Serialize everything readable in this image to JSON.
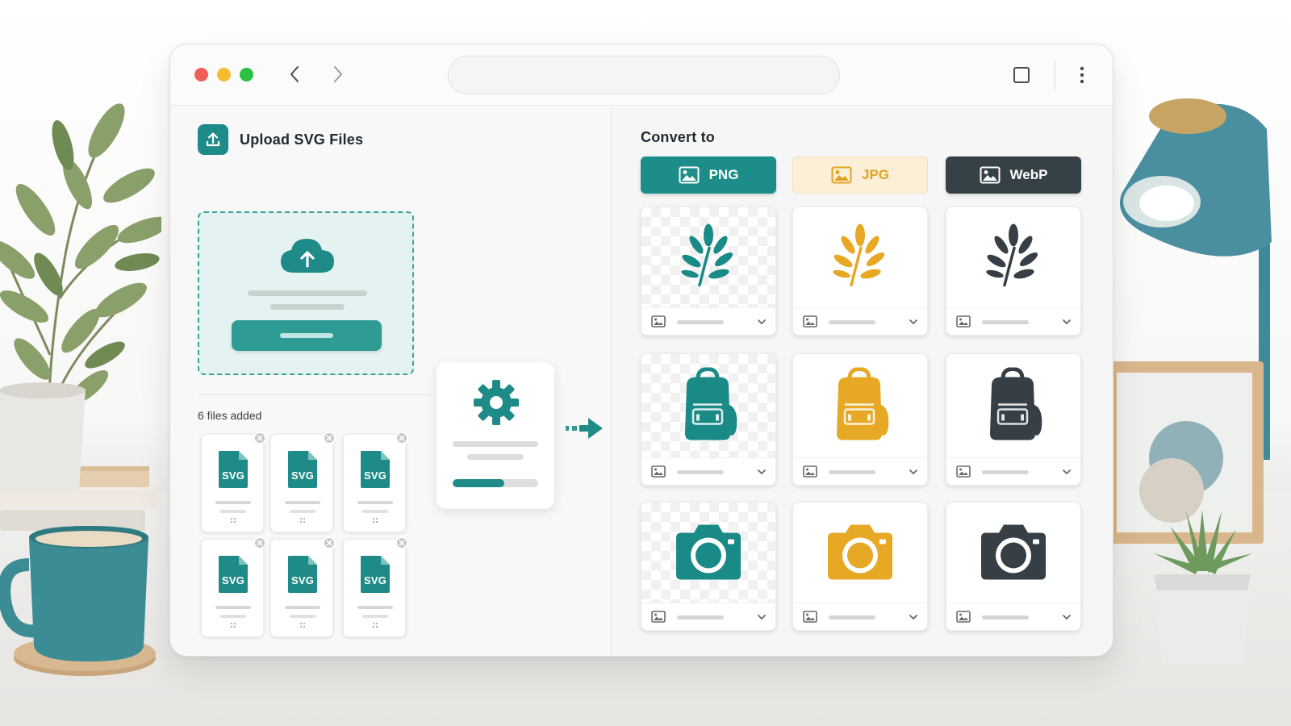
{
  "left_panel": {
    "upload_title": "Upload SVG Files",
    "files_added_label": "6 files added",
    "files": [
      {
        "ext": "SVG"
      },
      {
        "ext": "SVG"
      },
      {
        "ext": "SVG"
      },
      {
        "ext": "SVG"
      },
      {
        "ext": "SVG"
      },
      {
        "ext": "SVG"
      }
    ]
  },
  "processing": {
    "progress": 0.6,
    "icon": "gear-icon"
  },
  "right_panel": {
    "convert_title": "Convert to",
    "formats": [
      {
        "label": "PNG",
        "color": "#1c8d89",
        "selected": true
      },
      {
        "label": "JPG",
        "color": "#e2a324",
        "selected": false
      },
      {
        "label": "WebP",
        "color": "#364147",
        "selected": false
      }
    ],
    "results": [
      {
        "icon": "leaf-icon",
        "format": "PNG",
        "color": "#1a8a86",
        "transparent_bg": true
      },
      {
        "icon": "leaf-icon",
        "format": "JPG",
        "color": "#e6a825",
        "transparent_bg": false
      },
      {
        "icon": "leaf-icon",
        "format": "WebP",
        "color": "#353f45",
        "transparent_bg": false
      },
      {
        "icon": "backpack-icon",
        "format": "PNG",
        "color": "#1a8a86",
        "transparent_bg": true
      },
      {
        "icon": "backpack-icon",
        "format": "JPG",
        "color": "#e6a825",
        "transparent_bg": false
      },
      {
        "icon": "backpack-icon",
        "format": "WebP",
        "color": "#353f45",
        "transparent_bg": false
      },
      {
        "icon": "camera-icon",
        "format": "PNG",
        "color": "#1a8a86",
        "transparent_bg": true
      },
      {
        "icon": "camera-icon",
        "format": "JPG",
        "color": "#e6a825",
        "transparent_bg": false
      },
      {
        "icon": "camera-icon",
        "format": "WebP",
        "color": "#353f45",
        "transparent_bg": false
      }
    ]
  },
  "colors": {
    "teal": "#1c8d89",
    "gold": "#e2a324",
    "slate": "#364147"
  }
}
